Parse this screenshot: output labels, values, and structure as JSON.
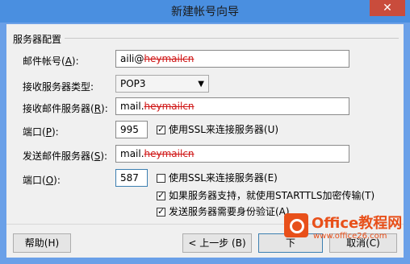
{
  "window": {
    "title": "新建帐号向导",
    "close_glyph": "✕"
  },
  "server_config": {
    "group_title": "服务器配置",
    "account_label": "邮件帐号(",
    "account_accel": "A",
    "account_label_end": "):",
    "account_value_visible": "aili@",
    "account_value_redacted": "heymailcn",
    "server_type_label": "接收服务器类型:",
    "server_type_value": "POP3",
    "incoming_label": "接收邮件服务器(",
    "incoming_accel": "R",
    "incoming_label_end": "):",
    "incoming_value_visible": "mail.",
    "incoming_value_redacted": "heymailcn",
    "incoming_port_label": "端口(",
    "incoming_port_accel": "P",
    "incoming_port_label_end": "):",
    "incoming_port_value": "995",
    "incoming_ssl_label": "使用SSL来连接服务器(U)",
    "incoming_ssl_checked": true,
    "outgoing_label": "发送邮件服务器(",
    "outgoing_accel": "S",
    "outgoing_label_end": "):",
    "outgoing_value_visible": "mail.",
    "outgoing_value_redacted": "heymailcn",
    "outgoing_port_label": "端口(",
    "outgoing_port_accel": "O",
    "outgoing_port_label_end": "):",
    "outgoing_port_value": "587",
    "outgoing_ssl_label": "使用SSL来连接服务器(E)",
    "outgoing_ssl_checked": false,
    "starttls_label": "如果服务器支持，就使用STARTTLS加密传输(T)",
    "starttls_checked": true,
    "auth_label": "发送服务器需要身份验证(A)",
    "auth_checked": true
  },
  "footer": {
    "help_label": "帮助(H)",
    "back_label": "< 上一步 (B)",
    "next_label": "下",
    "cancel_label": "取消(C)"
  },
  "watermark": {
    "brand": "Office教程网",
    "url": "www.office26.com"
  },
  "colors": {
    "titlebar": "#4a8fe0",
    "close": "#c94c3c",
    "redaction": "#d01818",
    "watermark": "#e8501a"
  }
}
